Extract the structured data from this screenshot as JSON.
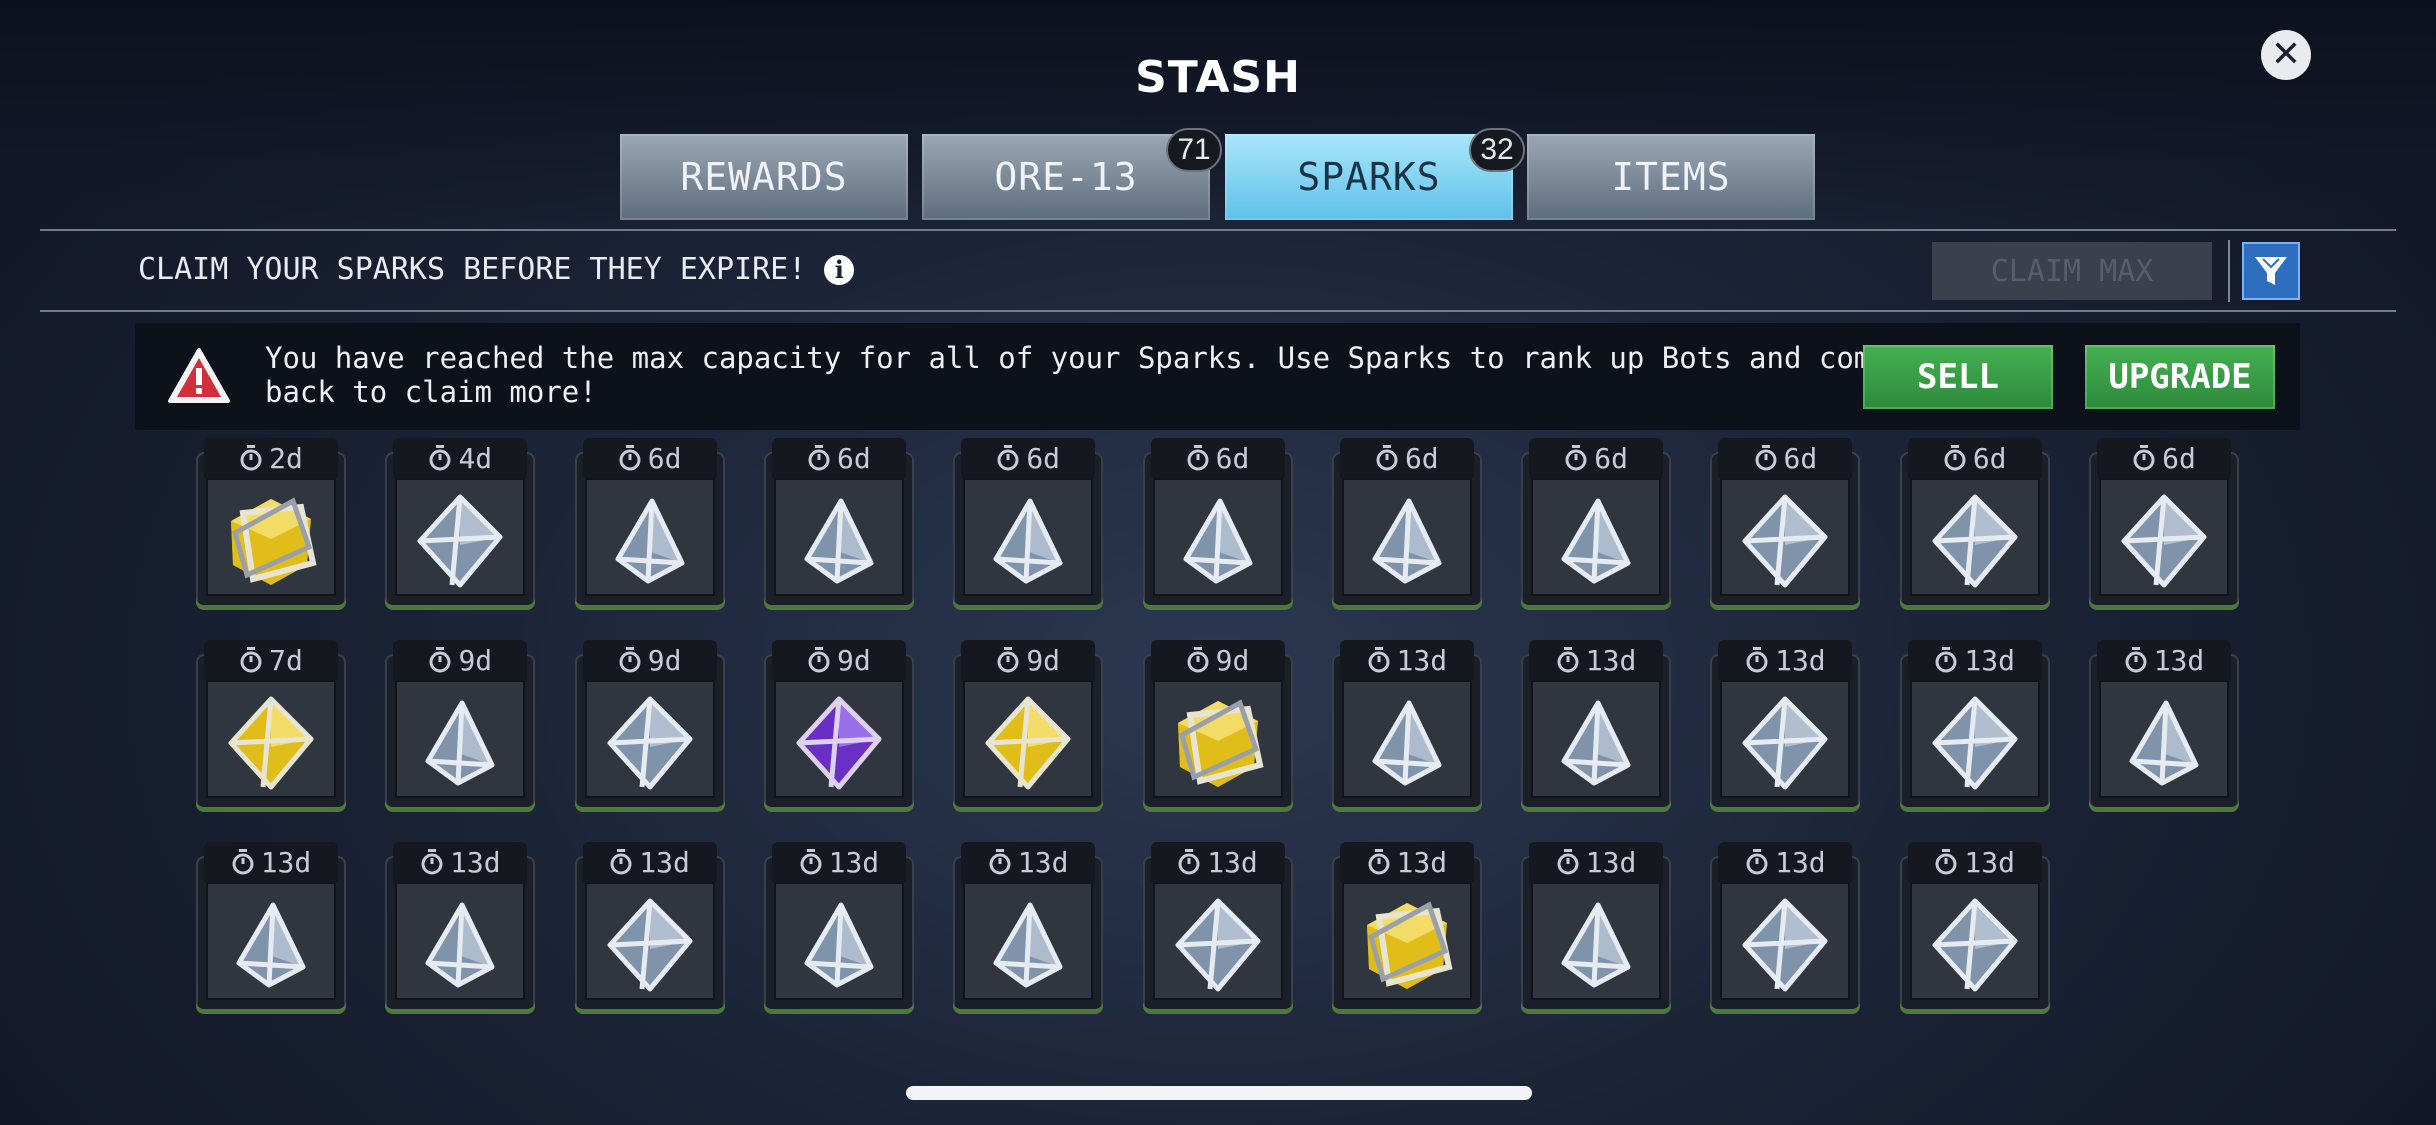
{
  "title": "STASH",
  "close_icon": "close-icon",
  "tabs": [
    {
      "label": "REWARDS",
      "badge": null,
      "active": false
    },
    {
      "label": "ORE-13",
      "badge": "71",
      "active": false
    },
    {
      "label": "SPARKS",
      "badge": "32",
      "active": true
    },
    {
      "label": "ITEMS",
      "badge": null,
      "active": false
    }
  ],
  "subheader": {
    "text": "CLAIM YOUR SPARKS BEFORE THEY EXPIRE!",
    "info_icon": "info-icon",
    "claim_max": "CLAIM MAX",
    "filter_icon": "filter-icon"
  },
  "banner": {
    "warning_icon": "warning-icon",
    "message": "You have reached the max capacity for all of your Sparks. Use Sparks to rank up Bots and come back to claim more!",
    "sell": "SELL",
    "upgrade": "UPGRADE"
  },
  "colors": {
    "gray": "#8e9cab",
    "gold": "#e9c418",
    "purple": "#7a35d0",
    "accent_blue": "#6cc8ef",
    "green": "#3b9e48"
  },
  "sparks": [
    {
      "time": "2d",
      "color": "gold",
      "shape": "cube"
    },
    {
      "time": "4d",
      "color": "gray",
      "shape": "octa"
    },
    {
      "time": "6d",
      "color": "gray",
      "shape": "tetra"
    },
    {
      "time": "6d",
      "color": "gray",
      "shape": "tetra"
    },
    {
      "time": "6d",
      "color": "gray",
      "shape": "tetra"
    },
    {
      "time": "6d",
      "color": "gray",
      "shape": "tetra"
    },
    {
      "time": "6d",
      "color": "gray",
      "shape": "tetra"
    },
    {
      "time": "6d",
      "color": "gray",
      "shape": "tetra"
    },
    {
      "time": "6d",
      "color": "gray",
      "shape": "octa"
    },
    {
      "time": "6d",
      "color": "gray",
      "shape": "octa"
    },
    {
      "time": "6d",
      "color": "gray",
      "shape": "octa"
    },
    {
      "time": "7d",
      "color": "gold",
      "shape": "octa"
    },
    {
      "time": "9d",
      "color": "gray",
      "shape": "tetra"
    },
    {
      "time": "9d",
      "color": "gray",
      "shape": "octa"
    },
    {
      "time": "9d",
      "color": "purple",
      "shape": "octa"
    },
    {
      "time": "9d",
      "color": "gold",
      "shape": "octa"
    },
    {
      "time": "9d",
      "color": "gold",
      "shape": "cube"
    },
    {
      "time": "13d",
      "color": "gray",
      "shape": "tetra"
    },
    {
      "time": "13d",
      "color": "gray",
      "shape": "tetra"
    },
    {
      "time": "13d",
      "color": "gray",
      "shape": "octa"
    },
    {
      "time": "13d",
      "color": "gray",
      "shape": "octa"
    },
    {
      "time": "13d",
      "color": "gray",
      "shape": "tetra"
    },
    {
      "time": "13d",
      "color": "gray",
      "shape": "tetra"
    },
    {
      "time": "13d",
      "color": "gray",
      "shape": "tetra"
    },
    {
      "time": "13d",
      "color": "gray",
      "shape": "octa"
    },
    {
      "time": "13d",
      "color": "gray",
      "shape": "tetra"
    },
    {
      "time": "13d",
      "color": "gray",
      "shape": "tetra"
    },
    {
      "time": "13d",
      "color": "gray",
      "shape": "octa"
    },
    {
      "time": "13d",
      "color": "gold",
      "shape": "cube"
    },
    {
      "time": "13d",
      "color": "gray",
      "shape": "tetra"
    },
    {
      "time": "13d",
      "color": "gray",
      "shape": "octa"
    },
    {
      "time": "13d",
      "color": "gray",
      "shape": "octa"
    }
  ]
}
